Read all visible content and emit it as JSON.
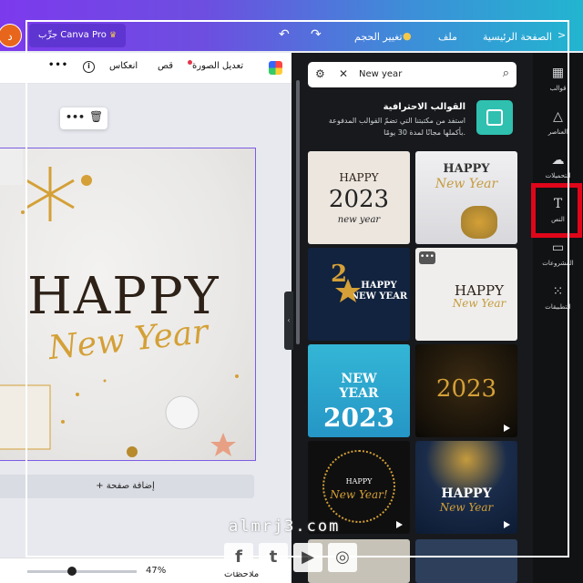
{
  "topbar": {
    "home": "الصفحة الرئيسية",
    "file": "ملف",
    "resize": "تغيير الحجم",
    "try_pro": "جرِّب Canva Pro",
    "avatar_letter": "د"
  },
  "toolbar": {
    "edit_image": "تعديل الصورة",
    "crop": "قص",
    "flip": "انعكاس",
    "info": "i",
    "more": "•••"
  },
  "canvas": {
    "headline": "HAPPY",
    "script": "New Year",
    "add_page": "+ إضافة صفحة"
  },
  "bottom": {
    "zoom": "47%",
    "notes": "ملاحظات"
  },
  "panel": {
    "search_value": "New year",
    "pro_title": "القوالب الاحترافية",
    "pro_desc_line1": "استفد من مكتبتنا التي تضمّ القوالب المدفوعة",
    "pro_desc_line2": "بأكملها مجانًا لمدة 30 يومًا.",
    "templates": [
      {
        "line1": "HAPPY",
        "line2": "2023",
        "line3": "new year"
      },
      {
        "line1": "HAPPY",
        "line2": "New Year",
        "line3": ""
      },
      {
        "line1": "2",
        "line2": "HAPPY",
        "line3": "NEW YEAR"
      },
      {
        "line1": "HAPPY",
        "line2": "New Year",
        "line3": ""
      },
      {
        "line1": "NEW",
        "line2": "YEAR",
        "line3": "2023"
      },
      {
        "line1": "2023",
        "line2": "",
        "line3": ""
      },
      {
        "line1": "HAPPY",
        "line2": "New Year!",
        "line3": ""
      },
      {
        "line1": "HAPPY",
        "line2": "New Year",
        "line3": ""
      }
    ]
  },
  "rail": [
    {
      "label": "قوالب",
      "icon": "templates-icon"
    },
    {
      "label": "العناصر",
      "icon": "elements-icon"
    },
    {
      "label": "التحميلات",
      "icon": "uploads-icon"
    },
    {
      "label": "النص",
      "icon": "text-icon"
    },
    {
      "label": "المشروعات",
      "icon": "projects-icon"
    },
    {
      "label": "التطبيقات",
      "icon": "apps-icon"
    }
  ],
  "watermark": "almrj3.com",
  "colors": {
    "accent_red": "#e0061a",
    "brand_gradient_start": "#7c3aed",
    "brand_gradient_end": "#22b5d0"
  }
}
